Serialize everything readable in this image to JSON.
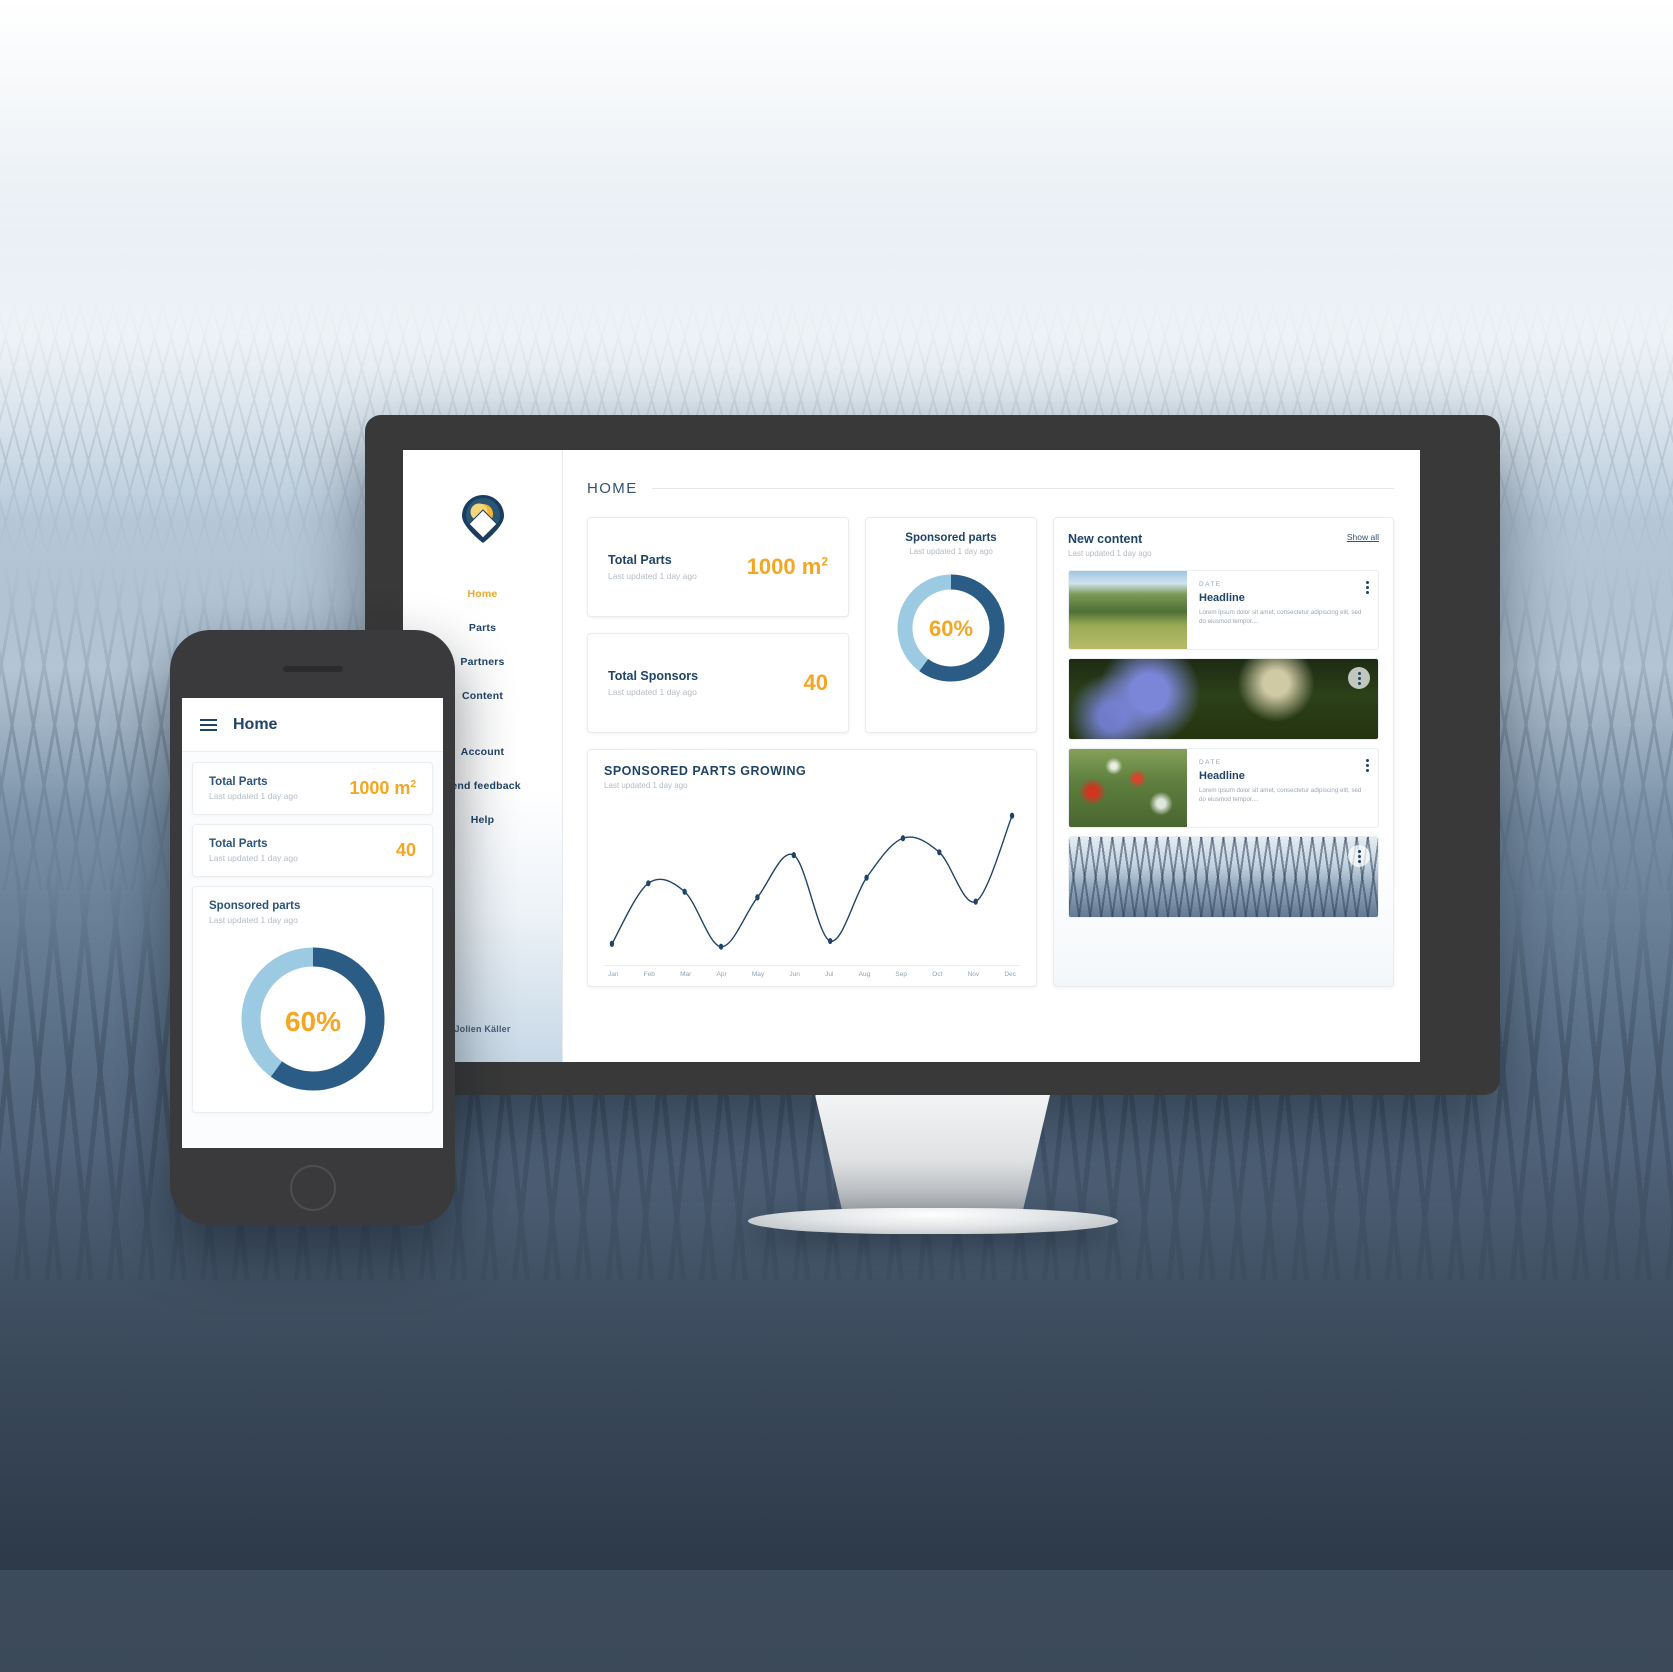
{
  "brand": {
    "logo_icon": "map-pin-sun-logo",
    "accent_orange": "#F5A623",
    "primary_blue": "#1F4468",
    "light_blue": "#9CCAE3"
  },
  "desktop": {
    "page_title": "HOME",
    "sidebar": {
      "items": [
        {
          "label": "Home",
          "active": true
        },
        {
          "label": "Parts",
          "active": false
        },
        {
          "label": "Partners",
          "active": false
        },
        {
          "label": "Content",
          "active": false
        },
        {
          "label": "Account",
          "active": false
        },
        {
          "label": "Send feedback",
          "active": false
        },
        {
          "label": "Help",
          "active": false
        }
      ],
      "user_name": "Jolien Käller"
    },
    "stat_cards": [
      {
        "title": "Total Parts",
        "subtitle": "Last updated 1 day ago",
        "value": "1000 m",
        "superscript": "2"
      },
      {
        "title": "Total Sponsors",
        "subtitle": "Last updated 1 day ago",
        "value": "40",
        "superscript": ""
      }
    ],
    "donut": {
      "title": "Sponsored parts",
      "subtitle": "Last updated 1 day ago",
      "label": "60%",
      "percent": 60
    },
    "chart_card": {
      "title": "SPONSORED PARTS GROWING",
      "subtitle": "Last updated 1 day ago"
    },
    "content_panel": {
      "title": "New content",
      "subtitle": "Last updated 1 day ago",
      "show_all_label": "Show all",
      "items": [
        {
          "thumb": "meadow-trees-photo",
          "date_label": "DATE",
          "headline": "Headline",
          "body": "Lorem ipsum dolor sit amet, consectetur adipiscing elit, sed do eiusmod tempor....",
          "layout": "side"
        },
        {
          "thumb": "cornflower-photo",
          "date_label": "",
          "headline": "",
          "body": "",
          "layout": "full"
        },
        {
          "thumb": "poppy-meadow-photo",
          "date_label": "DATE",
          "headline": "Headline",
          "body": "Lorem ipsum dolor sit amet, consectetur adipiscing elit, sed do eiusmod tempor....",
          "layout": "side"
        },
        {
          "thumb": "misty-forest-photo",
          "date_label": "",
          "headline": "",
          "body": "",
          "layout": "full"
        }
      ],
      "kebab_icon": "more-vertical-icon"
    }
  },
  "phone": {
    "menu_icon": "hamburger-menu-icon",
    "title": "Home",
    "cards": [
      {
        "title": "Total Parts",
        "subtitle": "Last updated 1 day ago",
        "value": "1000 m",
        "superscript": "2"
      },
      {
        "title": "Total Parts",
        "subtitle": "Last updated 1 day ago",
        "value": "40",
        "superscript": ""
      }
    ],
    "donut": {
      "title": "Sponsored parts",
      "subtitle": "Last updated 1 day ago",
      "label": "60%",
      "percent": 60
    }
  },
  "chart_data": {
    "type": "line",
    "title": "SPONSORED PARTS GROWING",
    "xlabel": "",
    "ylabel": "",
    "categories": [
      "Jan",
      "Feb",
      "Mar",
      "Apr",
      "May",
      "Jun",
      "Jul",
      "Aug",
      "Sep",
      "Oct",
      "Nov",
      "Dec"
    ],
    "values": [
      5,
      48,
      42,
      3,
      38,
      68,
      7,
      52,
      80,
      70,
      35,
      96
    ],
    "ylim": [
      0,
      100
    ],
    "grid": false,
    "legend": "none",
    "markers": true,
    "line_color": "#1F4468"
  }
}
